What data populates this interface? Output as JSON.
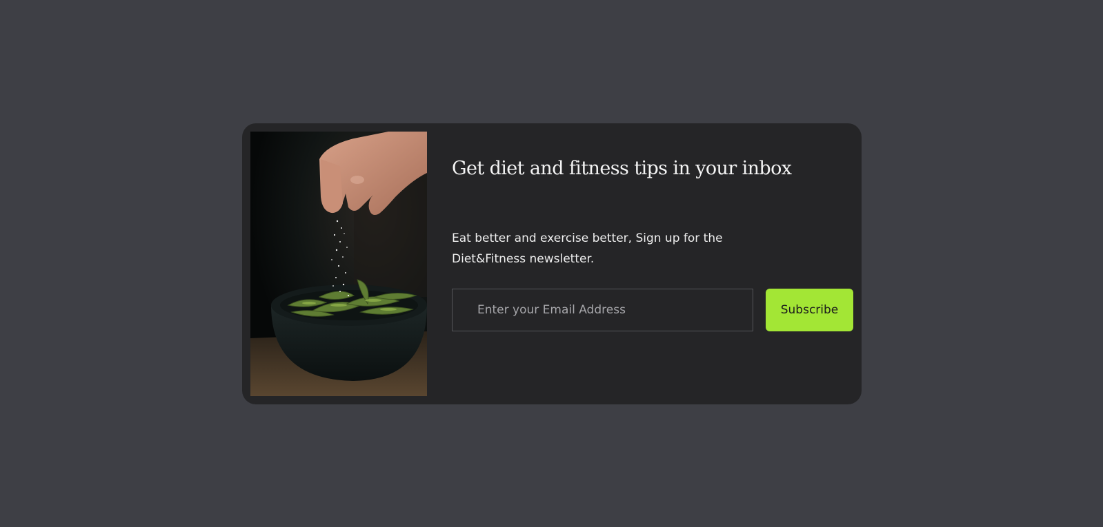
{
  "newsletter": {
    "title": "Get diet and fitness tips in your inbox",
    "description": "Eat better and exercise better, Sign up for the Diet&Fitness newsletter.",
    "email_placeholder": "Enter your Email Address",
    "email_value": "",
    "subscribe_label": "Subscribe"
  },
  "colors": {
    "page_background": "#3e3f45",
    "card_background": "#252527",
    "accent": "#a3e635",
    "text": "#eeeeee",
    "input_border": "#55565a"
  }
}
